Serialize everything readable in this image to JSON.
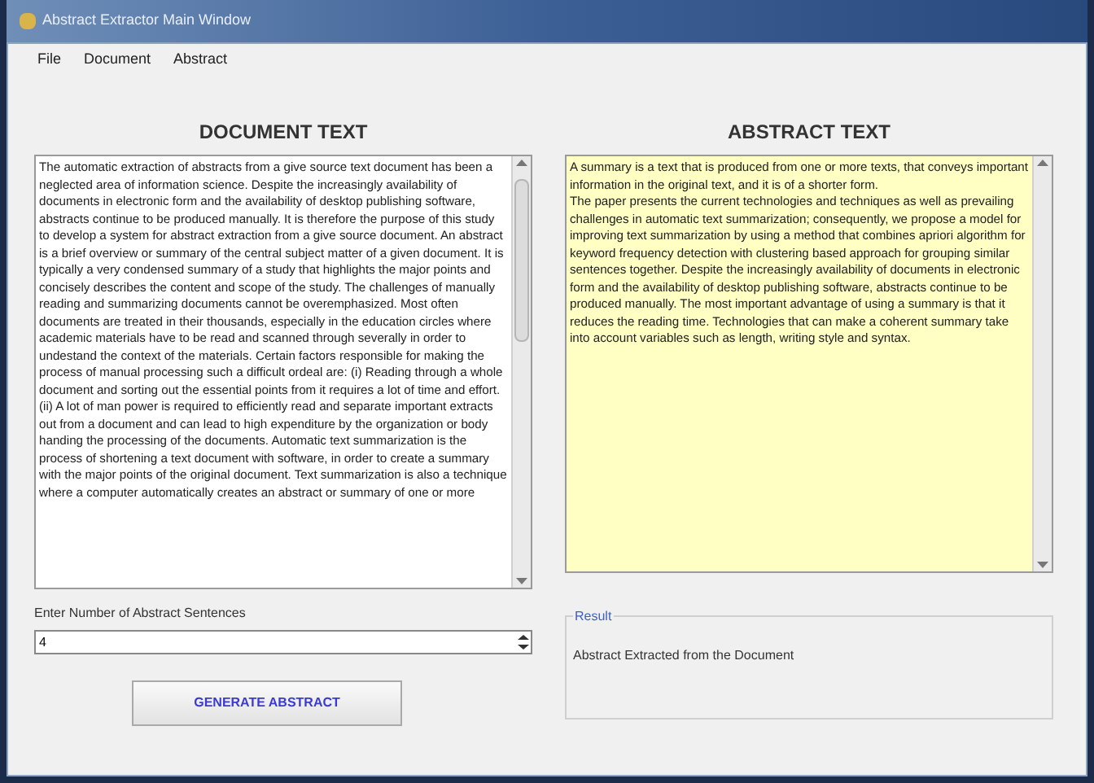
{
  "window": {
    "title": "Abstract Extractor Main Window"
  },
  "menu": [
    "File",
    "Document",
    "Abstract"
  ],
  "document_panel": {
    "heading": "DOCUMENT TEXT",
    "text": "The automatic extraction of abstracts from a give source text document has been a neglected area of information science. Despite the increasingly availability of documents in electronic form and the availability of desktop publishing software, abstracts continue to be produced manually. It is therefore the purpose of this study to develop a system for abstract extraction from a give source document. An abstract is a brief overview or summary of the central subject matter of a given document. It is typically a very condensed summary of a study that highlights the major points and concisely describes the content and scope of the study. The challenges of manually reading and summarizing documents cannot be overemphasized. Most often documents are treated in their thousands, especially in the education circles where academic materials have to be read and scanned through severally in order to undestand the context of the materials. Certain factors responsible for making the process of manual processing such a difficult ordeal are: (i) Reading through a whole document and sorting out the essential points from it requires a lot of time and effort. (ii) A lot of man power is required to efficiently read and separate important extracts out from a document and can lead to high expenditure by the organization or body handing the processing of the documents. Automatic text summarization is the process of shortening a text document with software, in order to create a summary with the major points of the original document. Text summarization is also a technique where a computer automatically creates an abstract or summary of one or more"
  },
  "abstract_panel": {
    "heading": "ABSTRACT TEXT",
    "paragraphs": [
      "A summary is a text that is produced from one or more texts, that conveys important information in the original text, and it is of a shorter form.",
      "The paper presents the current technologies and techniques as well as prevailing challenges in automatic text summarization; consequently, we propose a model for improving text summarization by using a method that combines apriori algorithm for keyword frequency detection with clustering based approach for grouping similar sentences together. Despite the increasingly availability of documents in electronic form and the availability of desktop publishing software, abstracts continue to be produced manually. The most important advantage of using a summary is that it reduces the reading time. Technologies that can make a coherent summary take into account variables such as length, writing style and syntax."
    ]
  },
  "sentences": {
    "label": "Enter Number of Abstract Sentences",
    "value": "4"
  },
  "generate_button": "GENERATE ABSTRACT",
  "result": {
    "legend": "Result",
    "text": "Abstract Extracted from the Document"
  }
}
